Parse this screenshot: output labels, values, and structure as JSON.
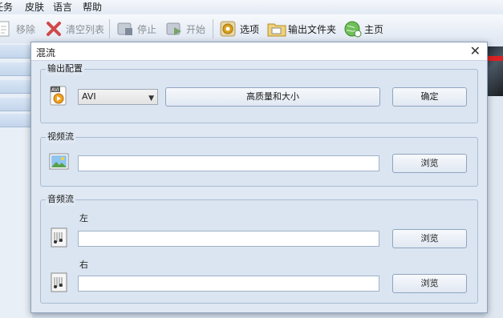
{
  "menubar": {
    "items": [
      "任务",
      "皮肤",
      "语言",
      "帮助"
    ]
  },
  "toolbar": {
    "remove": "移除",
    "clear_list": "清空列表",
    "stop": "停止",
    "start": "开始",
    "options": "选项",
    "output_folder": "输出文件夹",
    "home": "主页"
  },
  "dialog": {
    "title": "混流",
    "close": "✕",
    "output_group": {
      "label": "输出配置",
      "format_value": "AVI",
      "quality_button": "高质量和大小",
      "ok_button": "确定"
    },
    "video_group": {
      "label": "视频流",
      "path_value": "",
      "browse_button": "浏览"
    },
    "audio_group": {
      "label": "音频流",
      "left_label": "左",
      "left_path_value": "",
      "left_browse_button": "浏览",
      "right_label": "右",
      "right_path_value": "",
      "right_browse_button": "浏览"
    }
  }
}
